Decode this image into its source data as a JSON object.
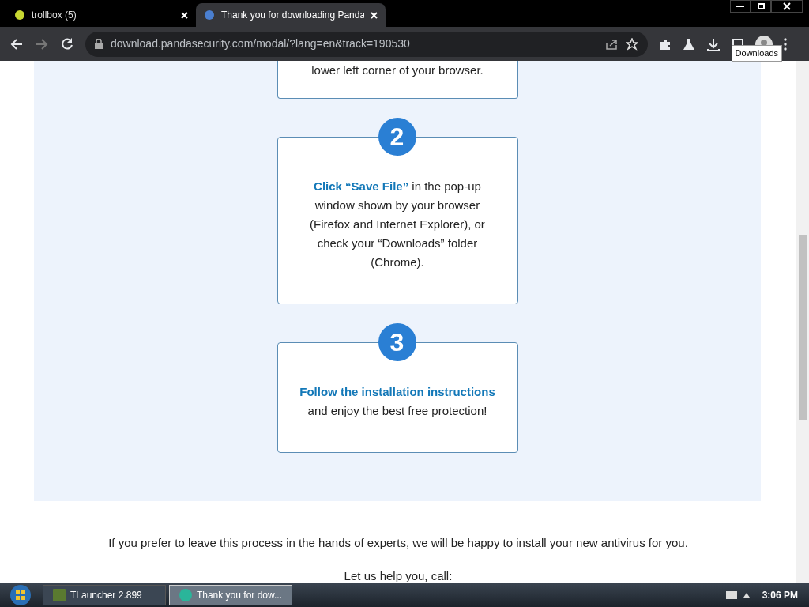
{
  "browser": {
    "tabs": [
      {
        "title": "trollbox (5)",
        "selected": false
      },
      {
        "title": "Thank you for downloading Panda",
        "selected": true
      }
    ],
    "address": "download.pandasecurity.com/modal/?lang=en&track=190530",
    "tooltip": "Downloads"
  },
  "steps": [
    {
      "text": "lower left corner of your browser."
    },
    {
      "number": "2",
      "text": "**Click “Save File”** in the pop-up\nwindow shown by your browser\n(Firefox and Internet Explorer), or\ncheck your “Downloads” folder\n(Chrome)."
    },
    {
      "number": "3",
      "text": "**Follow the installation instructions**\nand enjoy the best free protection!"
    }
  ],
  "help_text": "If you prefer to leave this process in the hands of experts, we will be happy to install your new antivirus for you.",
  "call_text": "Let us help you, call:",
  "taskbar": {
    "items": [
      {
        "label": "TLauncher 2.899",
        "selected": false
      },
      {
        "label": "Thank you for dow...",
        "selected": true
      }
    ],
    "clock": "3:06 PM"
  }
}
